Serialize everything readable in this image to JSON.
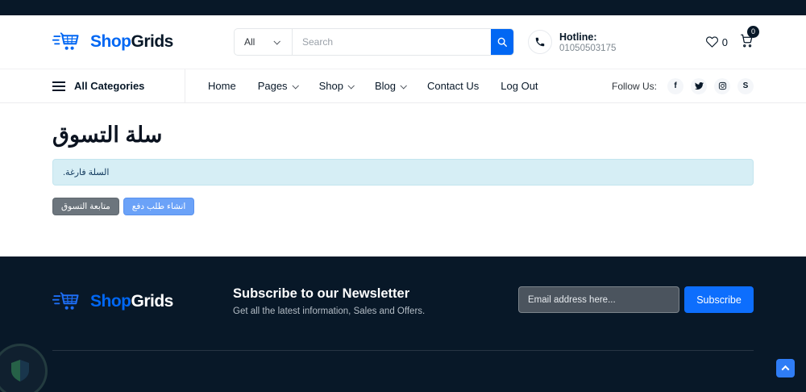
{
  "header": {
    "logo": {
      "shop": "Shop",
      "grids": "Grids"
    },
    "search": {
      "category": "All",
      "placeholder": "Search"
    },
    "hotline": {
      "label": "Hotline:",
      "number": "01050503175"
    },
    "wishlist_count": "0",
    "cart_badge": "0"
  },
  "nav": {
    "all_categories": "All Categories",
    "items": [
      {
        "label": "Home",
        "dropdown": false
      },
      {
        "label": "Pages",
        "dropdown": true
      },
      {
        "label": "Shop",
        "dropdown": true
      },
      {
        "label": "Blog",
        "dropdown": true
      },
      {
        "label": "Contact Us",
        "dropdown": false
      },
      {
        "label": "Log Out",
        "dropdown": false
      }
    ],
    "follow_label": "Follow Us:",
    "social": [
      "facebook",
      "twitter",
      "instagram",
      "skype"
    ]
  },
  "main": {
    "title": "سلة التسوق",
    "alert": "السلة فارغة.",
    "continue_button": "متابعة التسوق",
    "checkout_button": "انشاء طلب دفع"
  },
  "footer": {
    "logo": {
      "shop": "Shop",
      "grids": "Grids"
    },
    "newsletter_title": "Subscribe to our Newsletter",
    "newsletter_subtitle": "Get all the latest information, Sales and Offers.",
    "email_placeholder": "Email address here...",
    "subscribe_label": "Subscribe"
  },
  "icons": {
    "facebook": "f",
    "skype": "S"
  },
  "colors": {
    "accent_blue": "#0167f3",
    "dark_navy": "#081828",
    "subscribe_blue": "#0d6efd",
    "light_blue_button": "#6ba2f8",
    "gray_button": "#6c757d",
    "alert_bg": "#d6eef5"
  }
}
